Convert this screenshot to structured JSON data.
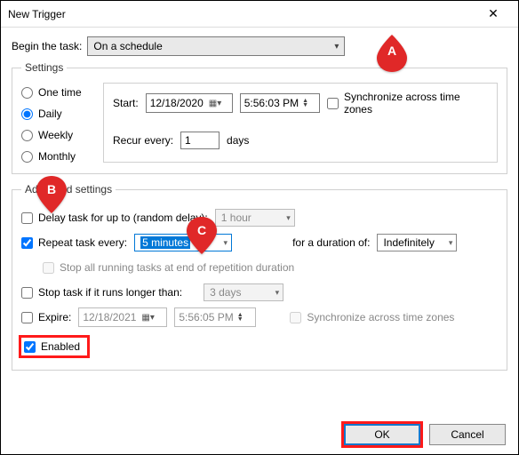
{
  "window": {
    "title": "New Trigger",
    "close_glyph": "✕"
  },
  "begin": {
    "label": "Begin the task:",
    "value": "On a schedule"
  },
  "settings": {
    "legend": "Settings",
    "radios": {
      "onetime": "One time",
      "daily": "Daily",
      "weekly": "Weekly",
      "monthly": "Monthly",
      "selected": "daily"
    },
    "start_label": "Start:",
    "start_date": "12/18/2020",
    "start_time": "5:56:03 PM",
    "sync_label": "Synchronize across time zones",
    "recur_label": "Recur every:",
    "recur_value": "1",
    "recur_unit": "days"
  },
  "advanced": {
    "legend": "Advanced settings",
    "delay_label": "Delay task for up to (random delay):",
    "delay_value": "1 hour",
    "repeat_label": "Repeat task every:",
    "repeat_value": "5 minutes",
    "duration_label": "for a duration of:",
    "duration_value": "Indefinitely",
    "stop_all_label": "Stop all running tasks at end of repetition duration",
    "stop_longer_label": "Stop task if it runs longer than:",
    "stop_longer_value": "3 days",
    "expire_label": "Expire:",
    "expire_date": "12/18/2021",
    "expire_time": "5:56:05 PM",
    "sync2_label": "Synchronize across time zones",
    "enabled_label": "Enabled"
  },
  "buttons": {
    "ok": "OK",
    "cancel": "Cancel"
  },
  "callouts": {
    "a": "A",
    "b": "B",
    "c": "C"
  }
}
